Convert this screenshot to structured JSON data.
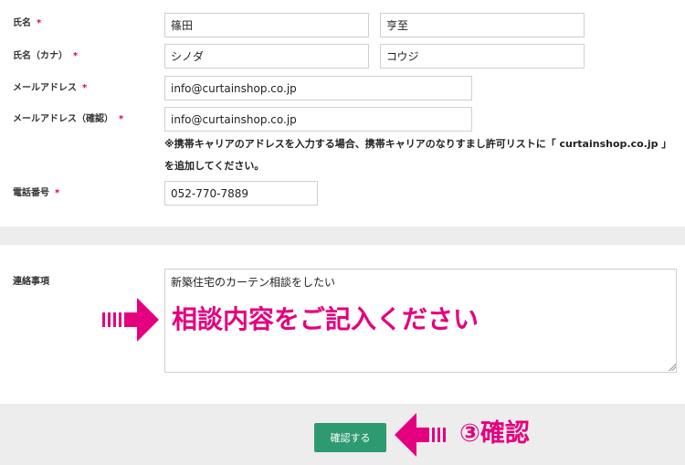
{
  "form": {
    "name": {
      "label": "氏名",
      "required_mark": "*",
      "last": "篠田",
      "first": "亨至"
    },
    "kana": {
      "label": "氏名（カナ）",
      "required_mark": "*",
      "last": "シノダ",
      "first": "コウジ"
    },
    "email": {
      "label": "メールアドレス",
      "required_mark": "*",
      "value": "info@curtainshop.co.jp"
    },
    "email_confirm": {
      "label": "メールアドレス（確認）",
      "required_mark": "*",
      "value": "info@curtainshop.co.jp",
      "note": "※携帯キャリアのアドレスを入力する場合、携帯キャリアのなりすまし許可リストに「 curtainshop.co.jp 」を追加してください。"
    },
    "phone": {
      "label": "電話番号",
      "required_mark": "*",
      "value": "052-770-7889"
    },
    "message": {
      "label": "連絡事項",
      "value": "新築住宅のカーテン相談をしたい"
    }
  },
  "buttons": {
    "confirm_label": "確認する"
  },
  "annotations": {
    "message_hint": "相談内容をご記入ください",
    "confirm_hint": "③確認"
  },
  "colors": {
    "accent_pink": "#e4007f",
    "button_green": "#2e9a72",
    "band_gray": "#ededed"
  }
}
